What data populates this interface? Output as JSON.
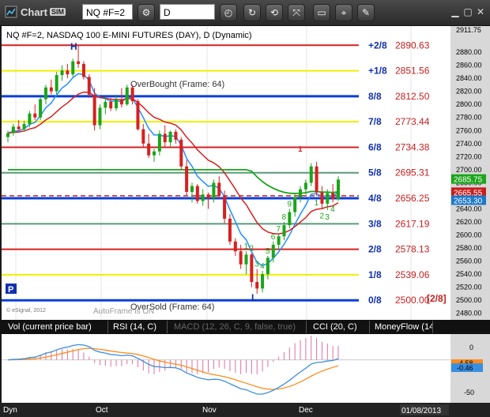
{
  "toolbar": {
    "title": "Chart",
    "badge": "SIM",
    "symbol": "NQ #F=2",
    "interval": "D"
  },
  "chart_header": "NQ #F=2, NASDAQ 100 E-MINI FUTURES (DAY), D (Dynamic)",
  "annotations": {
    "overbought": "OverBought (Frame: 64)",
    "oversold": "OverSold (Frame: 64)",
    "copyright": "© eSignal, 2012",
    "autoframe": "AutoFrame is ON",
    "frame_note": "[2/8]",
    "panel_marker": "P",
    "high_marker": "H",
    "low_marker": "L",
    "seq_top": "1",
    "seq_up": [
      "1",
      "2",
      "3",
      "4",
      "5",
      "6",
      "7",
      "8",
      "9"
    ],
    "seq_down": [
      "1",
      "2",
      "3",
      "4"
    ]
  },
  "murrey_levels": [
    {
      "label": "+2/8",
      "value": "2890.63",
      "color": "#d62020"
    },
    {
      "label": "+1/8",
      "value": "2851.56",
      "color": "#f0f000"
    },
    {
      "label": "8/8",
      "value": "2812.50",
      "color": "#0a3fd8"
    },
    {
      "label": "7/8",
      "value": "2773.44",
      "color": "#f0f000"
    },
    {
      "label": "6/8",
      "value": "2734.38",
      "color": "#d62020"
    },
    {
      "label": "5/8",
      "value": "2695.31",
      "color": "#5a9a7a"
    },
    {
      "label": "4/8",
      "value": "2656.25",
      "color": "#0a3fd8"
    },
    {
      "label": "3/8",
      "value": "2617.19",
      "color": "#5a9a7a"
    },
    {
      "label": "2/8",
      "value": "2578.13",
      "color": "#d62020"
    },
    {
      "label": "1/8",
      "value": "2539.06",
      "color": "#f0f000"
    },
    {
      "label": "0/8",
      "value": "2500.00",
      "color": "#0a3fd8"
    }
  ],
  "price_axis": {
    "ticks": [
      "2880.00",
      "2860.00",
      "2840.00",
      "2820.00",
      "2800.00",
      "2780.00",
      "2760.00",
      "2740.00",
      "2720.00",
      "2700.00",
      "2680.00",
      "2660.00",
      "2640.00",
      "2620.00",
      "2600.00",
      "2580.00",
      "2560.00",
      "2540.00",
      "2520.00",
      "2500.00",
      "2480.00"
    ],
    "top_label": "2911.75",
    "last_price": {
      "label": "2685.75",
      "color": "#1aa51a"
    },
    "red_line": {
      "label": "2665.55",
      "color": "#c81e1e"
    },
    "blue_line": {
      "label": "2653.30",
      "color": "#1e78c8"
    }
  },
  "macd_axis": {
    "ticks": [
      "0",
      "-50"
    ],
    "signal_label": "-4.58",
    "macd_label": "-0.46"
  },
  "time_axis": {
    "labels": [
      "Oct",
      "Nov",
      "Dec"
    ],
    "corner_label": "Dyn",
    "date_label": "01/08/2013"
  },
  "study_tabs": [
    {
      "label": "Vol (current price bar)",
      "dim": false
    },
    {
      "label": "RSI (14, C)",
      "dim": false
    },
    {
      "label": "MACD (12, 26, C, 9, false, true)",
      "dim": true
    },
    {
      "label": "CCI (20, C)",
      "dim": false
    },
    {
      "label": "MoneyFlow (14",
      "dim": false
    }
  ],
  "chart_data": {
    "type": "candlestick",
    "title": "NQ #F=2, NASDAQ 100 E-MINI FUTURES (DAY), D (Dynamic)",
    "ylim": [
      2470,
      2920
    ],
    "x_labels": [
      "Oct",
      "Nov",
      "Dec"
    ],
    "ohlc": [
      [
        2750,
        2760,
        2742,
        2756
      ],
      [
        2756,
        2770,
        2752,
        2766
      ],
      [
        2766,
        2776,
        2760,
        2762
      ],
      [
        2762,
        2775,
        2758,
        2770
      ],
      [
        2770,
        2790,
        2765,
        2786
      ],
      [
        2786,
        2800,
        2776,
        2780
      ],
      [
        2780,
        2812,
        2776,
        2808
      ],
      [
        2808,
        2830,
        2800,
        2826
      ],
      [
        2826,
        2838,
        2815,
        2820
      ],
      [
        2820,
        2850,
        2815,
        2845
      ],
      [
        2845,
        2860,
        2836,
        2852
      ],
      [
        2852,
        2862,
        2840,
        2846
      ],
      [
        2846,
        2870,
        2842,
        2866
      ],
      [
        2866,
        2890,
        2856,
        2862
      ],
      [
        2862,
        2866,
        2838,
        2842
      ],
      [
        2842,
        2846,
        2810,
        2815
      ],
      [
        2815,
        2825,
        2760,
        2768
      ],
      [
        2768,
        2800,
        2762,
        2795
      ],
      [
        2795,
        2812,
        2785,
        2804
      ],
      [
        2804,
        2810,
        2790,
        2794
      ],
      [
        2794,
        2815,
        2790,
        2808
      ],
      [
        2808,
        2825,
        2795,
        2800
      ],
      [
        2800,
        2830,
        2798,
        2826
      ],
      [
        2826,
        2830,
        2800,
        2805
      ],
      [
        2805,
        2808,
        2760,
        2762
      ],
      [
        2762,
        2770,
        2735,
        2740
      ],
      [
        2740,
        2755,
        2718,
        2722
      ],
      [
        2722,
        2732,
        2712,
        2728
      ],
      [
        2728,
        2760,
        2722,
        2755
      ],
      [
        2755,
        2768,
        2735,
        2742
      ],
      [
        2742,
        2760,
        2735,
        2758
      ],
      [
        2758,
        2762,
        2740,
        2746
      ],
      [
        2746,
        2750,
        2700,
        2705
      ],
      [
        2705,
        2715,
        2660,
        2666
      ],
      [
        2666,
        2680,
        2650,
        2675
      ],
      [
        2675,
        2678,
        2648,
        2652
      ],
      [
        2652,
        2670,
        2645,
        2662
      ],
      [
        2662,
        2665,
        2640,
        2656
      ],
      [
        2656,
        2685,
        2650,
        2680
      ],
      [
        2680,
        2690,
        2655,
        2660
      ],
      [
        2660,
        2668,
        2618,
        2625
      ],
      [
        2625,
        2632,
        2585,
        2590
      ],
      [
        2590,
        2595,
        2568,
        2575
      ],
      [
        2575,
        2585,
        2548,
        2555
      ],
      [
        2555,
        2575,
        2540,
        2570
      ],
      [
        2570,
        2572,
        2520,
        2528
      ],
      [
        2528,
        2548,
        2510,
        2518
      ],
      [
        2518,
        2545,
        2512,
        2540
      ],
      [
        2540,
        2568,
        2532,
        2565
      ],
      [
        2565,
        2590,
        2558,
        2585
      ],
      [
        2585,
        2602,
        2578,
        2598
      ],
      [
        2598,
        2620,
        2592,
        2615
      ],
      [
        2615,
        2640,
        2610,
        2635
      ],
      [
        2635,
        2662,
        2628,
        2658
      ],
      [
        2658,
        2675,
        2650,
        2670
      ],
      [
        2670,
        2685,
        2662,
        2680
      ],
      [
        2680,
        2710,
        2675,
        2705
      ],
      [
        2705,
        2712,
        2660,
        2665
      ],
      [
        2665,
        2675,
        2640,
        2648
      ],
      [
        2648,
        2670,
        2638,
        2664
      ],
      [
        2664,
        2678,
        2650,
        2655
      ],
      [
        2655,
        2690,
        2652,
        2685
      ]
    ]
  }
}
